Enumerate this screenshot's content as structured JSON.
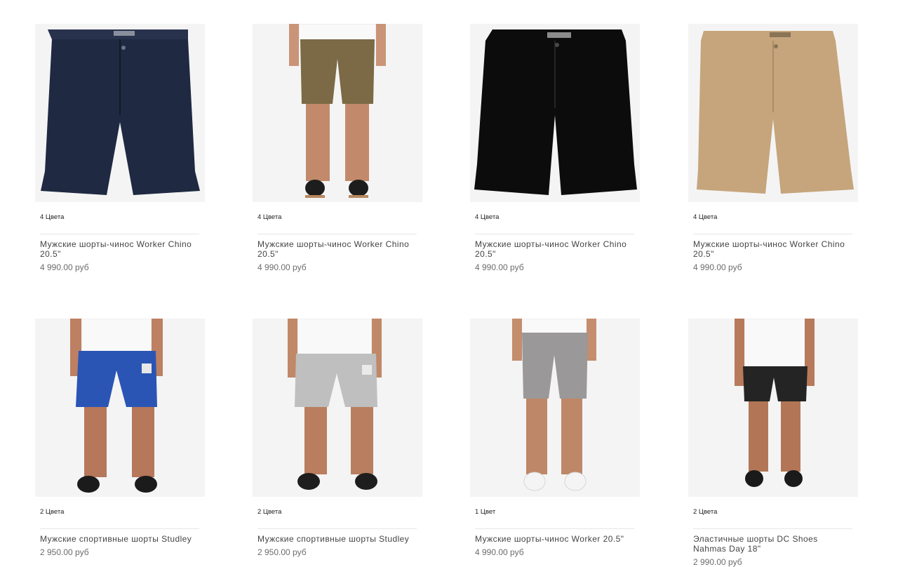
{
  "products": [
    {
      "colors": "4 Цвета",
      "title": "Мужские шорты-чинос Worker Chino 20.5\"",
      "price": "4 990.00 руб",
      "image": "navy-chino-shorts"
    },
    {
      "colors": "4 Цвета",
      "title": "Мужские шорты-чинос Worker Chino 20.5\"",
      "price": "4 990.00 руб",
      "image": "olive-chino-shorts-on-model"
    },
    {
      "colors": "4 Цвета",
      "title": "Мужские шорты-чинос Worker Chino 20.5\"",
      "price": "4 990.00 руб",
      "image": "black-chino-shorts"
    },
    {
      "colors": "4 Цвета",
      "title": "Мужские шорты-чинос Worker Chino 20.5\"",
      "price": "4 990.00 руб",
      "image": "khaki-chino-shorts"
    },
    {
      "colors": "2 Цвета",
      "title": "Мужские спортивные шорты Studley",
      "price": "2 950.00 руб",
      "image": "blue-sweat-shorts-on-model"
    },
    {
      "colors": "2 Цвета",
      "title": "Мужские спортивные шорты Studley",
      "price": "2 950.00 руб",
      "image": "grey-sweat-shorts-on-model"
    },
    {
      "colors": "1 Цвет",
      "title": "Мужские шорты-чинос Worker 20.5\"",
      "price": "4 990.00 руб",
      "image": "grey-chino-shorts-on-model"
    },
    {
      "colors": "2 Цвета",
      "title": "Эластичные шорты DC Shoes Nahmas Day 18\"",
      "price": "2 990.00 руб",
      "image": "black-elastic-shorts-on-model"
    }
  ],
  "colors": {
    "background": "#ffffff",
    "photo_background": "#f4f4f4",
    "price_text": "#6c6c6c",
    "title_text": "#444444"
  }
}
